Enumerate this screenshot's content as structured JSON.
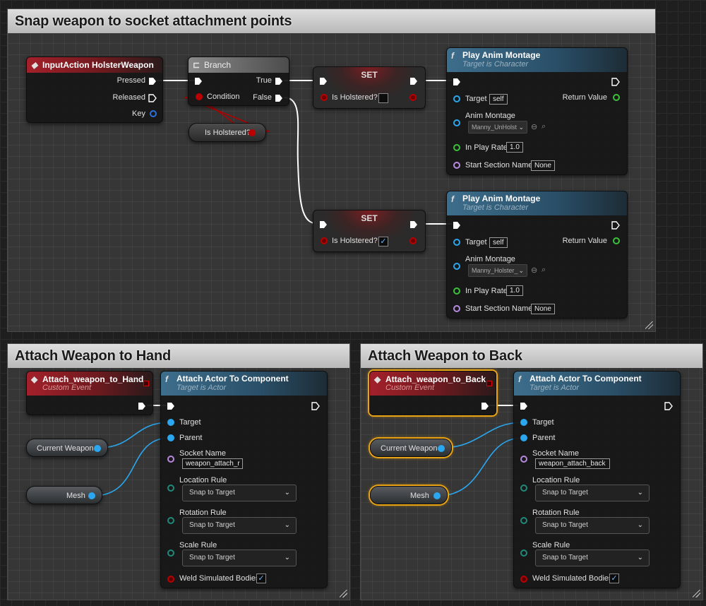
{
  "comments": {
    "top": {
      "title": "Snap weapon to socket attachment points"
    },
    "hand": {
      "title": "Attach Weapon to Hand"
    },
    "back": {
      "title": "Attach Weapon to Back"
    }
  },
  "input_node": {
    "title": "InputAction HolsterWeapon",
    "pins": [
      "Pressed",
      "Released",
      "Key"
    ]
  },
  "branch_node": {
    "title": "Branch",
    "condition": "Condition",
    "true": "True",
    "false": "False"
  },
  "holster_get": {
    "label": "Is Holstered?"
  },
  "set_true": {
    "title": "SET",
    "var": "Is Holstered?",
    "checked": false
  },
  "set_false": {
    "title": "SET",
    "var": "Is Holstered?",
    "checked": true
  },
  "montage1": {
    "title": "Play Anim Montage",
    "subtitle": "Target is Character",
    "target": "Target",
    "target_val": "self",
    "return": "Return Value",
    "anim": "Anim Montage",
    "anim_val": "Manny_UnHolst",
    "rate": "In Play Rate",
    "rate_val": "1.0",
    "section": "Start Section Name",
    "section_val": "None"
  },
  "montage2": {
    "title": "Play Anim Montage",
    "subtitle": "Target is Character",
    "target": "Target",
    "target_val": "self",
    "return": "Return Value",
    "anim": "Anim Montage",
    "anim_val": "Manny_Holster_",
    "rate": "In Play Rate",
    "rate_val": "1.0",
    "section": "Start Section Name",
    "section_val": "None"
  },
  "hand_event": {
    "title": "Attach_weapon_to_Hand",
    "subtitle": "Custom Event"
  },
  "back_event": {
    "title": "Attach_weapon_to_Back",
    "subtitle": "Custom Event"
  },
  "hand_vars": {
    "weapon": "Current Weapon",
    "mesh": "Mesh"
  },
  "back_vars": {
    "weapon": "Current Weapon",
    "mesh": "Mesh"
  },
  "attach_hand": {
    "title": "Attach Actor To Component",
    "subtitle": "Target is Actor",
    "target": "Target",
    "parent": "Parent",
    "socket": "Socket Name",
    "socket_val": "weapon_attach_r",
    "loc": "Location Rule",
    "loc_val": "Snap to Target",
    "rot": "Rotation Rule",
    "rot_val": "Snap to Target",
    "scale": "Scale Rule",
    "scale_val": "Snap to Target",
    "weld": "Weld Simulated Bodies",
    "weld_checked": true
  },
  "attach_back": {
    "title": "Attach Actor To Component",
    "subtitle": "Target is Actor",
    "target": "Target",
    "parent": "Parent",
    "socket": "Socket Name",
    "socket_val": "weapon_attach_back",
    "loc": "Location Rule",
    "loc_val": "Snap to Target",
    "rot": "Rotation Rule",
    "rot_val": "Snap to Target",
    "scale": "Scale Rule",
    "scale_val": "Snap to Target",
    "weld": "Weld Simulated Bodies",
    "weld_checked": true
  },
  "colors": {
    "exec": "#ffffff",
    "object": "#2aa7ef",
    "bool": "#b00000",
    "float": "#3bc23b",
    "name": "#b78ae0",
    "enum": "#1f8a7a",
    "selection": "#e8a317"
  }
}
